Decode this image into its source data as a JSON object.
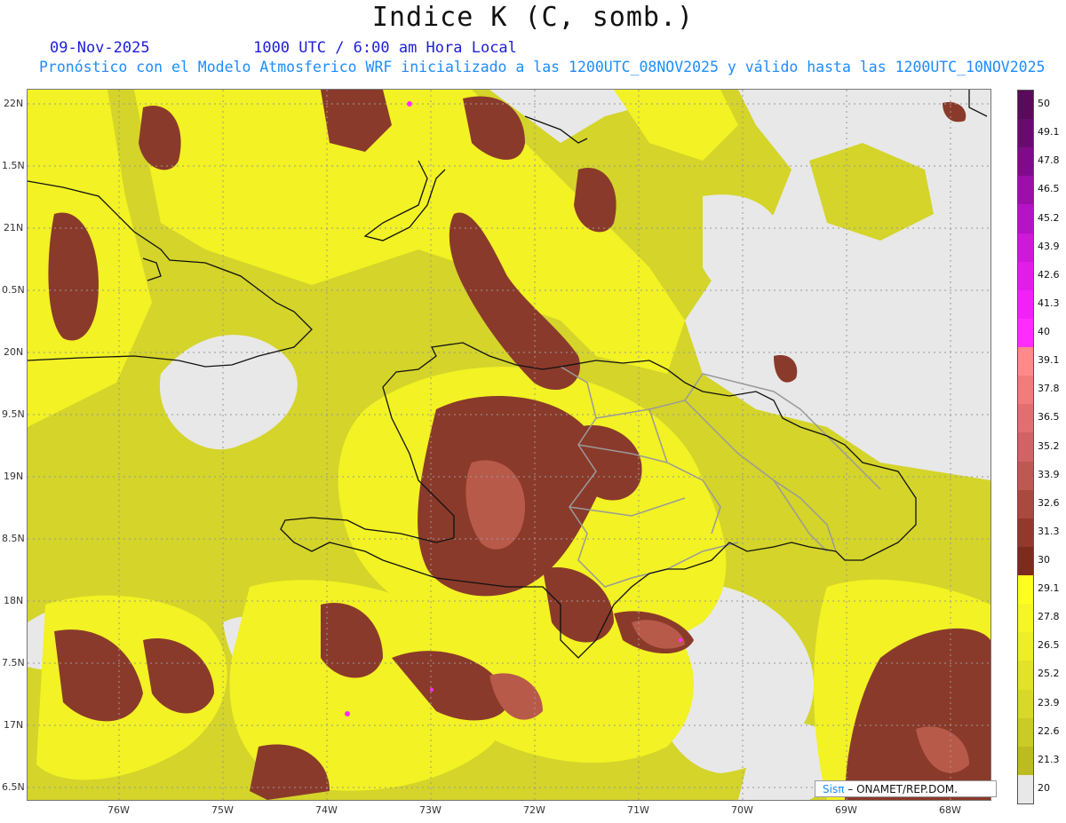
{
  "header": {
    "title": "Indice K (C, somb.)",
    "date": "09-Nov-2025",
    "time": "1000 UTC / 6:00 am Hora Local",
    "validity": "Pronóstico con el Modelo Atmosferico WRF inicializado a las 1200UTC_08NOV2025 y válido hasta las  1200UTC_10NOV2025"
  },
  "axes": {
    "lat_labels": [
      "22N",
      "1.5N",
      "21N",
      "0.5N",
      "20N",
      "9.5N",
      "19N",
      "8.5N",
      "18N",
      "7.5N",
      "17N",
      "6.5N"
    ],
    "lon_labels": [
      "76W",
      "75W",
      "74W",
      "73W",
      "72W",
      "71W",
      "70W",
      "69W",
      "68W"
    ]
  },
  "colorbar": {
    "labels": [
      "50",
      "49.1",
      "47.8",
      "46.5",
      "45.2",
      "43.9",
      "42.6",
      "41.3",
      "40",
      "39.1",
      "37.8",
      "36.5",
      "35.2",
      "33.9",
      "32.6",
      "31.3",
      "30",
      "29.1",
      "27.8",
      "26.5",
      "25.2",
      "23.9",
      "22.6",
      "21.3",
      "20"
    ],
    "colors": [
      "#5a0a5a",
      "#6a0a70",
      "#800a8c",
      "#9a10a8",
      "#b414c4",
      "#cc1ad8",
      "#e01ee8",
      "#f022f6",
      "#ff2cff",
      "#ff8a8a",
      "#f07c7c",
      "#e07070",
      "#d06464",
      "#bc5a52",
      "#a84a3e",
      "#94382c",
      "#7e2a1c",
      "#ffff1e",
      "#f6f624",
      "#eeee26",
      "#e2e228",
      "#d8d82a",
      "#caca28",
      "#bcbc22",
      "#e8e8e8"
    ]
  },
  "legend": {
    "sis": "Sisπ",
    "org": "– ONAMET/REP.DOM."
  },
  "colors": {
    "no_data": "#e8e8e8",
    "k_20_25": "#d4d42a",
    "k_25_30": "#f2f224",
    "k_30_33": "#8a3a2a",
    "k_33_36": "#b85a4a",
    "k_40plus": "#ff2cff",
    "coastline": "#111111",
    "provinces": "#9a9a9a"
  }
}
